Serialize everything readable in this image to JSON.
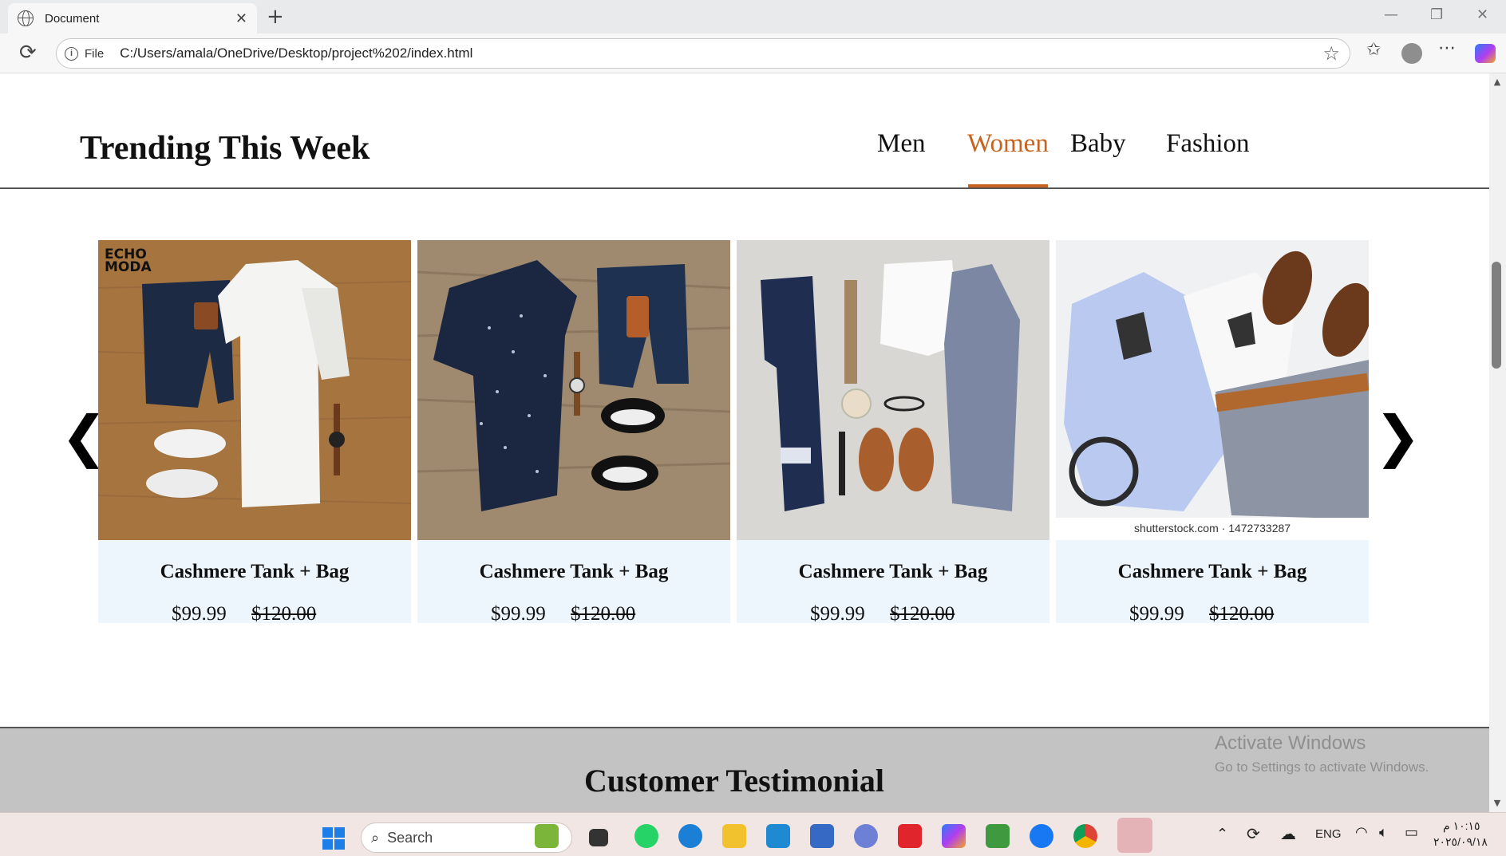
{
  "browser": {
    "tab_title": "Document",
    "tab_close": "✕",
    "new_tab": "+",
    "url_label": "File",
    "url": "C:/Users/amala/OneDrive/Desktop/project%202/index.html",
    "window_controls": [
      "—",
      "❐",
      "✕"
    ]
  },
  "trending": {
    "title": "Trending This Week",
    "nav": [
      {
        "label": "Men",
        "active": false
      },
      {
        "label": "Women",
        "active": true
      },
      {
        "label": "Baby",
        "active": false
      },
      {
        "label": "Fashion",
        "active": false
      }
    ],
    "prev_arrow": "❮",
    "next_arrow": "❯",
    "products": [
      {
        "name": "Cashmere Tank + Bag",
        "price": "$99.99",
        "old_price": "$120.00",
        "badge": "ECHO MODA"
      },
      {
        "name": "Cashmere Tank + Bag",
        "price": "$99.99",
        "old_price": "$120.00"
      },
      {
        "name": "Cashmere Tank + Bag",
        "price": "$99.99",
        "old_price": "$120.00"
      },
      {
        "name": "Cashmere Tank + Bag",
        "price": "$99.99",
        "old_price": "$120.00",
        "watermark": "shutterstock.com · 1472733287"
      }
    ]
  },
  "testimonial": {
    "title": "Customer Testimonial"
  },
  "watermark": {
    "line1": "Activate Windows",
    "line2": "Go to Settings to activate Windows."
  },
  "taskbar": {
    "search_placeholder": "Search",
    "language": "ENG",
    "time": "١٠:١٥ م",
    "date": "٢٠٢٥/٠٩/١٨",
    "icons": [
      "bamboo-widget-icon",
      "task-view-icon",
      "whatsapp-icon",
      "edge-icon",
      "file-explorer-icon",
      "vscode-icon",
      "store-icon",
      "app-icon",
      "wps-icon",
      "copilot-icon",
      "hexagon-app-icon",
      "messenger-icon",
      "chrome-icon",
      "snipping-tool-icon"
    ]
  },
  "colors": {
    "accent": "#c8631f",
    "card_bg": "#eef6fd",
    "testimonial_bg": "#c3c3c3"
  }
}
